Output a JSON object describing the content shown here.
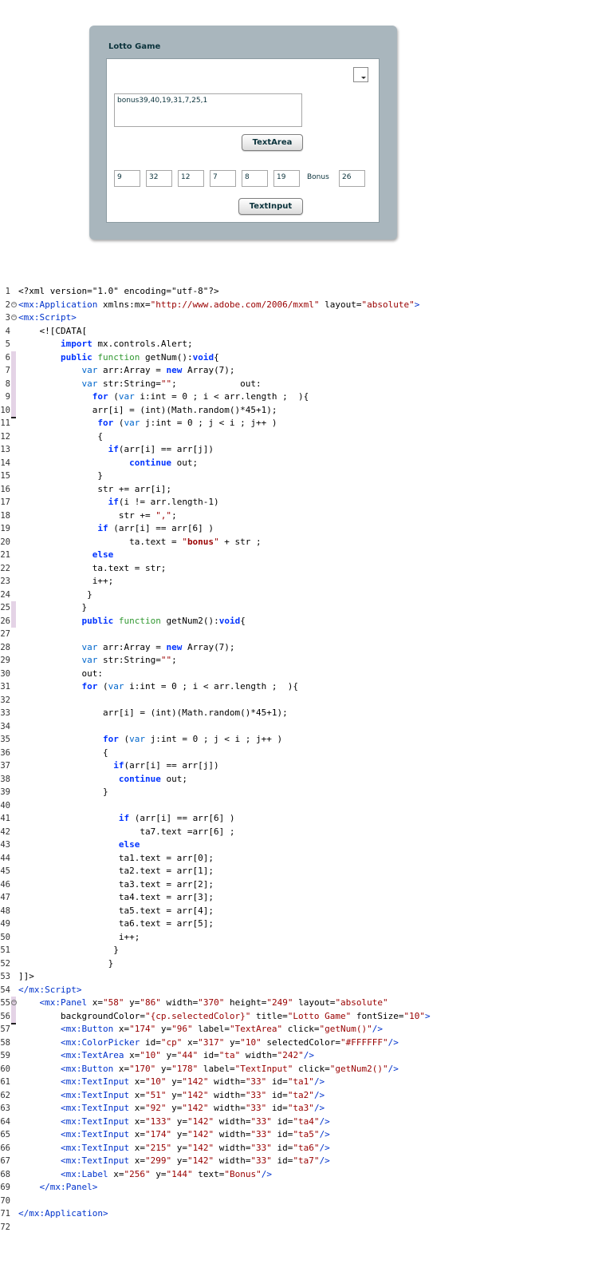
{
  "panel": {
    "title": "Lotto Game",
    "textarea_value": "bonus39,40,19,31,7,25,1",
    "textarea_button": "TextArea",
    "textinput_button": "TextInput",
    "inputs": [
      "9",
      "32",
      "12",
      "7",
      "8",
      "19"
    ],
    "bonus_label": "Bonus",
    "bonus_value": "26",
    "colorpicker_color": "#FFFFFF"
  },
  "code": {
    "lines": [
      {
        "n": "1",
        "html": "&lt;?xml version=\"1.0\" encoding=\"utf-8\"?&gt;"
      },
      {
        "n": "2",
        "html": "<span class='tag'>&lt;mx:Application</span> xmlns:mx=<span class='val'>\"http://www.adobe.com/2006/mxml\"</span> layout=<span class='val'>\"absolute\"</span><span class='tag'>&gt;</span>",
        "fold": true
      },
      {
        "n": "3",
        "html": "<span class='tag'>&lt;mx:Script&gt;</span>",
        "fold": true
      },
      {
        "n": "4",
        "html": "    &lt;![CDATA["
      },
      {
        "n": "5",
        "html": "        <span class='kw'>import</span> mx.controls.Alert;"
      },
      {
        "n": "6",
        "html": "        <span class='kw'>public</span> <span class='kw2'>function</span> getNum():<span class='kw'>void</span>{",
        "gutter": "mark"
      },
      {
        "n": "7",
        "html": "            <span class='ty'>var</span> arr:Array = <span class='kw'>new</span> Array(7);",
        "gutter": "sel"
      },
      {
        "n": "8",
        "html": "            <span class='ty'>var</span> str:String=<span class='str'>\"\"</span>;            out:",
        "gutter": "mark"
      },
      {
        "n": "9",
        "html": "              <span class='kw'>for</span> (<span class='ty'>var</span> i:int = 0 ; i &lt; arr.length ;  ){",
        "gutter": "mark"
      },
      {
        "n": "10",
        "html": "              arr[i] = (int)(Math.random()*45+1);",
        "gutter": "sel"
      },
      {
        "n": "11",
        "html": "               <span class='kw'>for</span> (<span class='ty'>var</span> j:int = 0 ; j &lt; i ; j++ )"
      },
      {
        "n": "12",
        "html": "               {"
      },
      {
        "n": "13",
        "html": "                 <span class='kw'>if</span>(arr[i] == arr[j])"
      },
      {
        "n": "14",
        "html": "                     <span class='kw'>continue</span> out;"
      },
      {
        "n": "15",
        "html": "               }"
      },
      {
        "n": "16",
        "html": "               str += arr[i];"
      },
      {
        "n": "17",
        "html": "                 <span class='kw'>if</span>(i != arr.length-1)"
      },
      {
        "n": "18",
        "html": "                   str += <span class='str'>\",\"</span>;"
      },
      {
        "n": "19",
        "html": "               <span class='kw'>if</span> (arr[i] == arr[6] )"
      },
      {
        "n": "20",
        "html": "                     ta.text = <span class='str'>\"<b>bonus</b>\"</span> + str ;"
      },
      {
        "n": "21",
        "html": "              <span class='kw'>else</span>"
      },
      {
        "n": "22",
        "html": "              ta.text = str;"
      },
      {
        "n": "23",
        "html": "              i++;"
      },
      {
        "n": "24",
        "html": "             }"
      },
      {
        "n": "25",
        "html": "            }",
        "gutter": "sel"
      },
      {
        "n": "26",
        "html": "            <span class='kw'>public</span> <span class='kw2'>function</span> getNum2():<span class='kw'>void</span>{",
        "gutter": "mark"
      },
      {
        "n": "27",
        "html": ""
      },
      {
        "n": "28",
        "html": "            <span class='ty'>var</span> arr:Array = <span class='kw'>new</span> Array(7);"
      },
      {
        "n": "29",
        "html": "            <span class='ty'>var</span> str:String=<span class='str'>\"\"</span>;"
      },
      {
        "n": "30",
        "html": "            out:"
      },
      {
        "n": "31",
        "html": "            <span class='kw'>for</span> (<span class='ty'>var</span> i:int = 0 ; i &lt; arr.length ;  ){"
      },
      {
        "n": "32",
        "html": ""
      },
      {
        "n": "33",
        "html": "                arr[i] = (int)(Math.random()*45+1);"
      },
      {
        "n": "34",
        "html": ""
      },
      {
        "n": "35",
        "html": "                <span class='kw'>for</span> (<span class='ty'>var</span> j:int = 0 ; j &lt; i ; j++ )"
      },
      {
        "n": "36",
        "html": "                {"
      },
      {
        "n": "37",
        "html": "                  <span class='kw'>if</span>(arr[i] == arr[j])"
      },
      {
        "n": "38",
        "html": "                   <span class='kw'>continue</span> out;"
      },
      {
        "n": "39",
        "html": "                }"
      },
      {
        "n": "40",
        "html": ""
      },
      {
        "n": "41",
        "html": "                   <span class='kw'>if</span> (arr[i] == arr[6] )"
      },
      {
        "n": "42",
        "html": "                       ta7.text =arr[6] ;"
      },
      {
        "n": "43",
        "html": "                   <span class='kw'>else</span>"
      },
      {
        "n": "44",
        "html": "                   ta1.text = arr[0];"
      },
      {
        "n": "45",
        "html": "                   ta2.text = arr[1];"
      },
      {
        "n": "46",
        "html": "                   ta3.text = arr[2];"
      },
      {
        "n": "47",
        "html": "                   ta4.text = arr[3];"
      },
      {
        "n": "48",
        "html": "                   ta5.text = arr[4];"
      },
      {
        "n": "49",
        "html": "                   ta6.text = arr[5];"
      },
      {
        "n": "50",
        "html": "                   i++;"
      },
      {
        "n": "51",
        "html": "                  }"
      },
      {
        "n": "52",
        "html": "                 }"
      },
      {
        "n": "53",
        "html": "]]&gt;"
      },
      {
        "n": "54",
        "html": "<span class='tag'>&lt;/mx:Script&gt;</span>"
      },
      {
        "n": "55",
        "html": "    <span class='tag'>&lt;mx:Panel</span> x=<span class='val'>\"58\"</span> y=<span class='val'>\"86\"</span> width=<span class='val'>\"370\"</span> height=<span class='val'>\"249\"</span> layout=<span class='val'>\"absolute\"</span>",
        "fold": true,
        "gutter": "mark"
      },
      {
        "n": "56",
        "html": "        backgroundColor=<span class='val'>\"{cp.selectedColor}\"</span> title=<span class='val'>\"Lotto Game\"</span> fontSize=<span class='val'>\"10\"</span><span class='tag'>&gt;</span>",
        "gutter": "sel"
      },
      {
        "n": "57",
        "html": "        <span class='tag'>&lt;mx:Button</span> x=<span class='val'>\"174\"</span> y=<span class='val'>\"96\"</span> label=<span class='val'>\"TextArea\"</span> click=<span class='val'>\"getNum()\"</span><span class='tag'>/&gt;</span>"
      },
      {
        "n": "58",
        "html": "        <span class='tag'>&lt;mx:ColorPicker</span> id=<span class='val'>\"cp\"</span> x=<span class='val'>\"317\"</span> y=<span class='val'>\"10\"</span> selectedColor=<span class='val'>\"#FFFFFF\"</span><span class='tag'>/&gt;</span>"
      },
      {
        "n": "59",
        "html": "        <span class='tag'>&lt;mx:TextArea</span> x=<span class='val'>\"10\"</span> y=<span class='val'>\"44\"</span> id=<span class='val'>\"ta\"</span> width=<span class='val'>\"242\"</span><span class='tag'>/&gt;</span>"
      },
      {
        "n": "60",
        "html": "        <span class='tag'>&lt;mx:Button</span> x=<span class='val'>\"170\"</span> y=<span class='val'>\"178\"</span> label=<span class='val'>\"TextInput\"</span> click=<span class='val'>\"getNum2()\"</span><span class='tag'>/&gt;</span>"
      },
      {
        "n": "61",
        "html": "        <span class='tag'>&lt;mx:TextInput</span> x=<span class='val'>\"10\"</span> y=<span class='val'>\"142\"</span> width=<span class='val'>\"33\"</span> id=<span class='val'>\"ta1\"</span><span class='tag'>/&gt;</span>"
      },
      {
        "n": "62",
        "html": "        <span class='tag'>&lt;mx:TextInput</span> x=<span class='val'>\"51\"</span> y=<span class='val'>\"142\"</span> width=<span class='val'>\"33\"</span> id=<span class='val'>\"ta2\"</span><span class='tag'>/&gt;</span>"
      },
      {
        "n": "63",
        "html": "        <span class='tag'>&lt;mx:TextInput</span> x=<span class='val'>\"92\"</span> y=<span class='val'>\"142\"</span> width=<span class='val'>\"33\"</span> id=<span class='val'>\"ta3\"</span><span class='tag'>/&gt;</span>"
      },
      {
        "n": "64",
        "html": "        <span class='tag'>&lt;mx:TextInput</span> x=<span class='val'>\"133\"</span> y=<span class='val'>\"142\"</span> width=<span class='val'>\"33\"</span> id=<span class='val'>\"ta4\"</span><span class='tag'>/&gt;</span>"
      },
      {
        "n": "65",
        "html": "        <span class='tag'>&lt;mx:TextInput</span> x=<span class='val'>\"174\"</span> y=<span class='val'>\"142\"</span> width=<span class='val'>\"33\"</span> id=<span class='val'>\"ta5\"</span><span class='tag'>/&gt;</span>"
      },
      {
        "n": "66",
        "html": "        <span class='tag'>&lt;mx:TextInput</span> x=<span class='val'>\"215\"</span> y=<span class='val'>\"142\"</span> width=<span class='val'>\"33\"</span> id=<span class='val'>\"ta6\"</span><span class='tag'>/&gt;</span>"
      },
      {
        "n": "67",
        "html": "        <span class='tag'>&lt;mx:TextInput</span> x=<span class='val'>\"299\"</span> y=<span class='val'>\"142\"</span> width=<span class='val'>\"33\"</span> id=<span class='val'>\"ta7\"</span><span class='tag'>/&gt;</span>"
      },
      {
        "n": "68",
        "html": "        <span class='tag'>&lt;mx:Label</span> x=<span class='val'>\"256\"</span> y=<span class='val'>\"144\"</span> text=<span class='val'>\"Bonus\"</span><span class='tag'>/&gt;</span>"
      },
      {
        "n": "69",
        "html": "    <span class='tag'>&lt;/mx:Panel&gt;</span>"
      },
      {
        "n": "70",
        "html": ""
      },
      {
        "n": "71",
        "html": "<span class='tag'>&lt;/mx:Application&gt;</span>"
      },
      {
        "n": "72",
        "html": ""
      }
    ]
  }
}
